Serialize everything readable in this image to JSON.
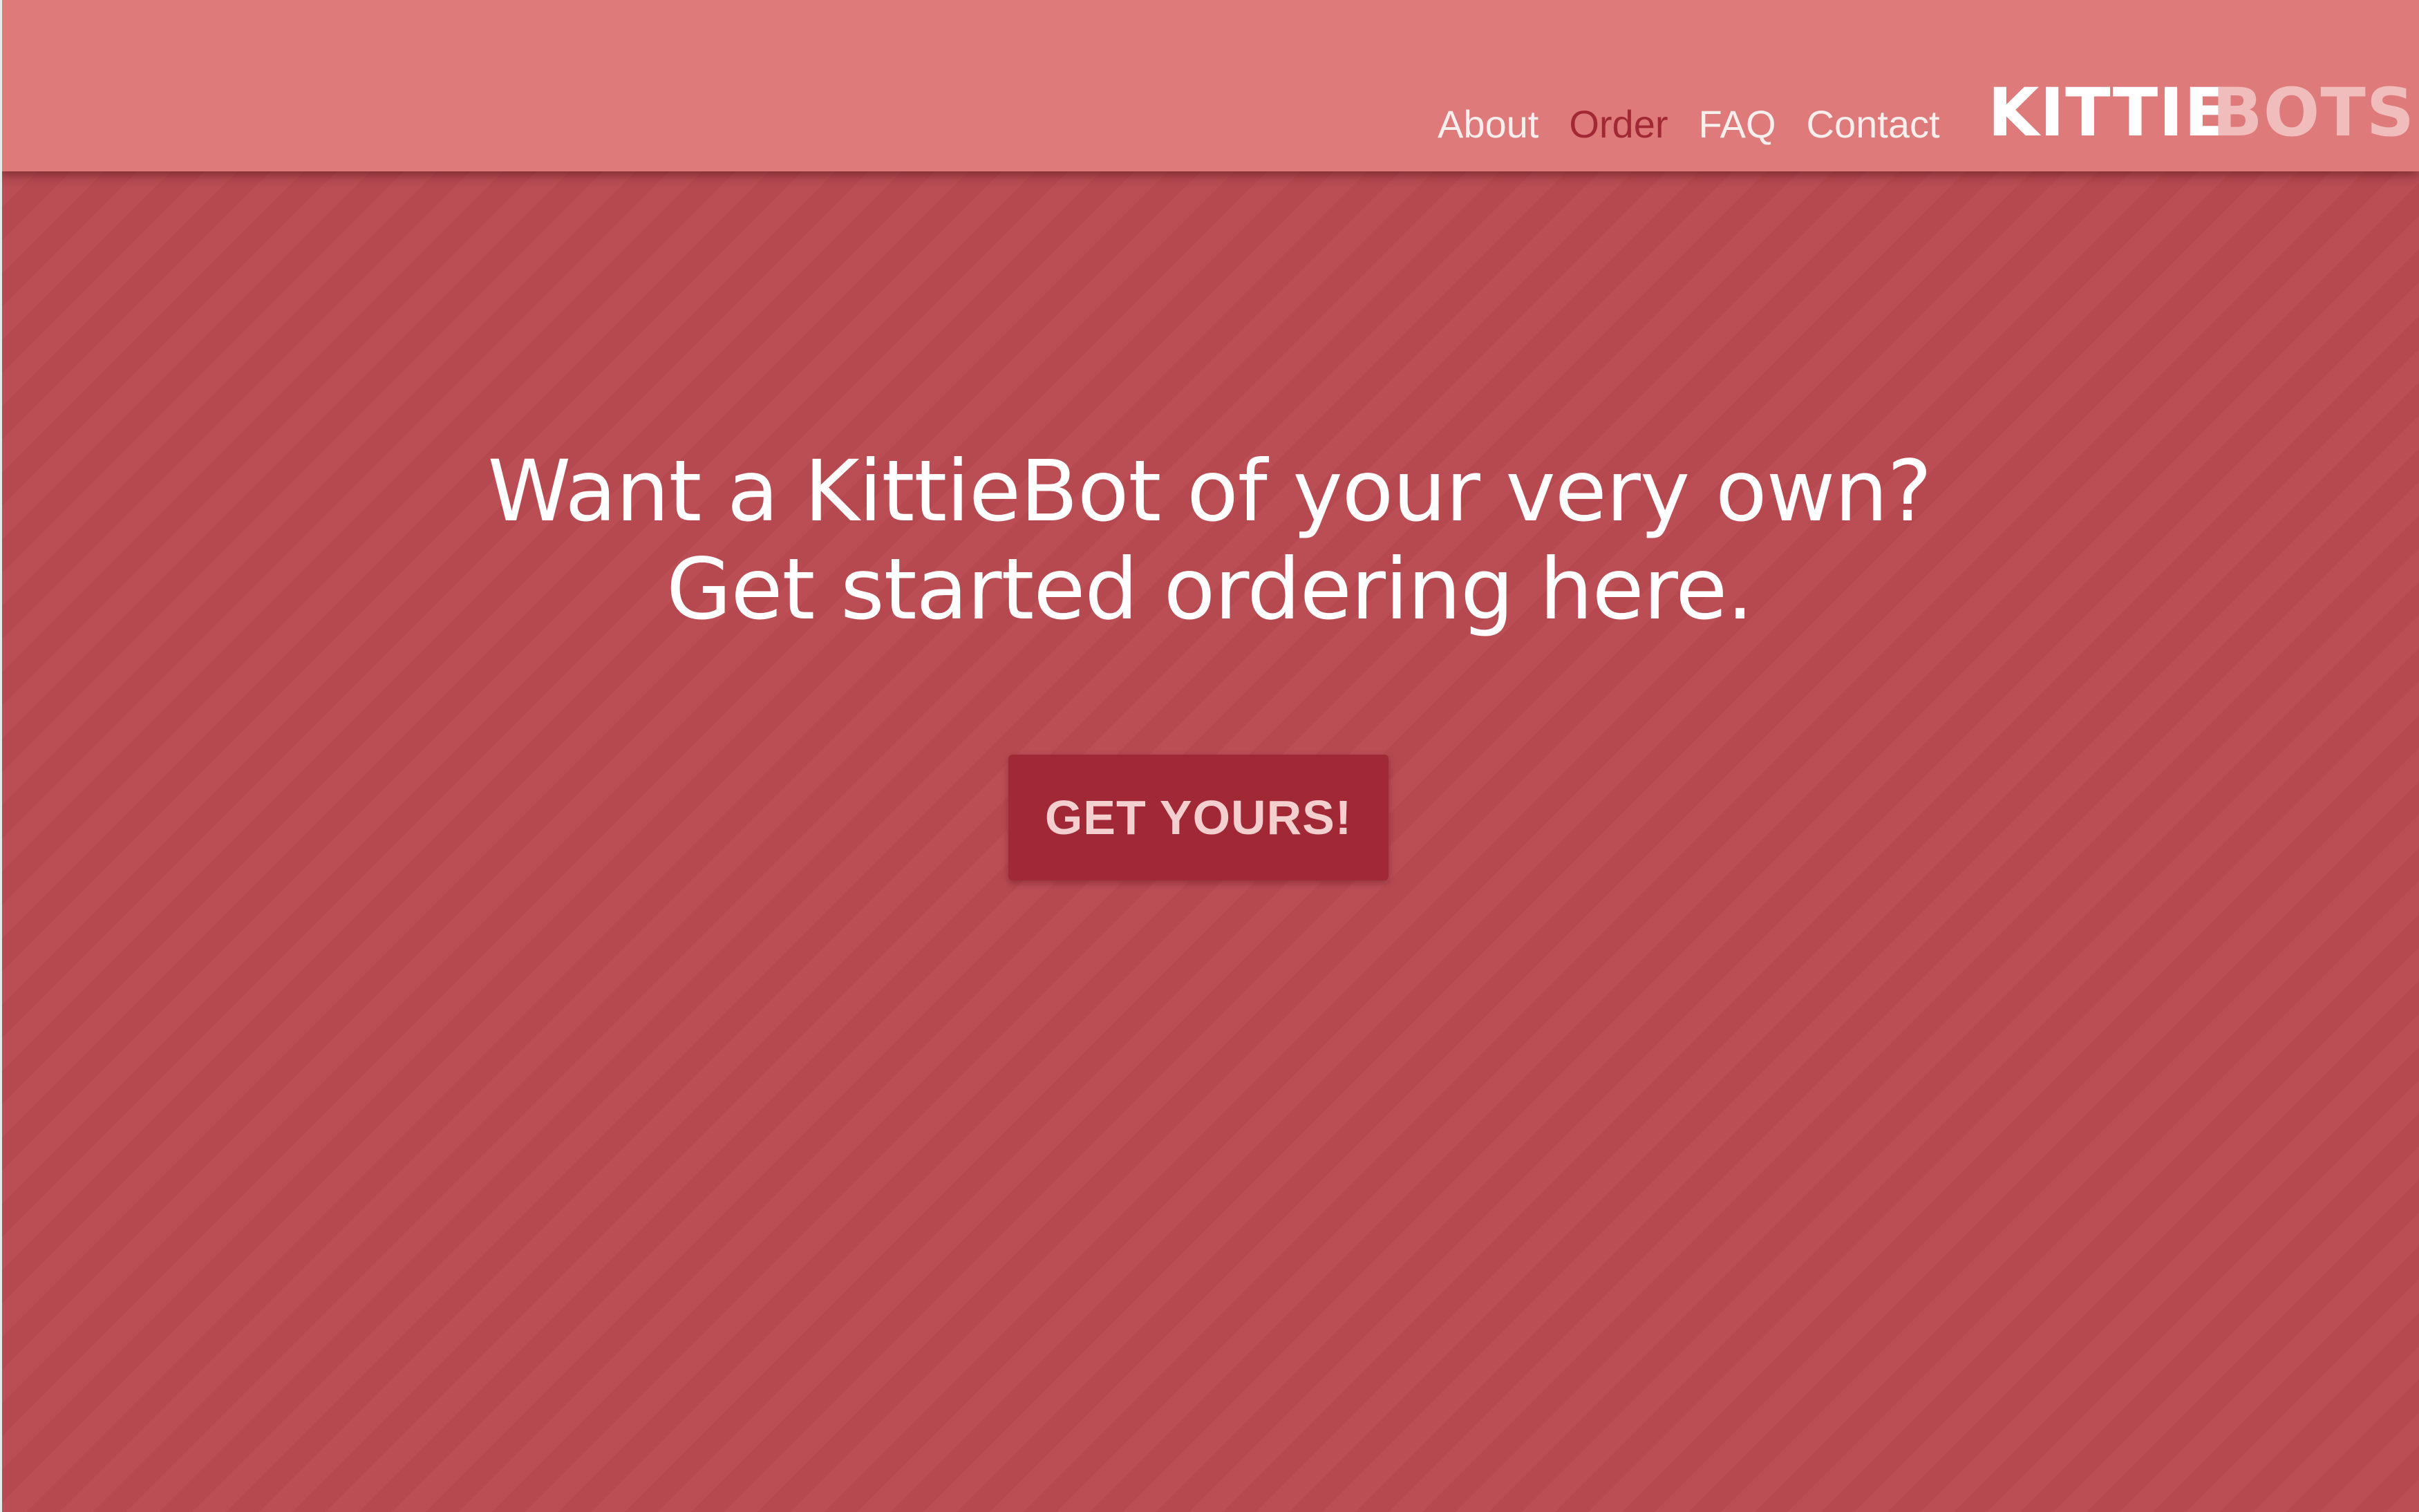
{
  "header": {
    "nav": [
      {
        "label": "About",
        "active": false
      },
      {
        "label": "Order",
        "active": true
      },
      {
        "label": "FAQ",
        "active": false
      },
      {
        "label": "Contact",
        "active": false
      }
    ],
    "logo": {
      "part1": "KITTIE",
      "part2": "BOTS"
    }
  },
  "hero": {
    "line1": "Want a KittieBot of your very own?",
    "line2": "Get started ordering here.",
    "cta_label": "GET YOURS!"
  },
  "colors": {
    "header_bg": "#de7a7a",
    "page_bg": "#ba4a52",
    "active_nav": "#a32836",
    "button_bg": "#a02935",
    "button_text": "#f4cfcf"
  }
}
